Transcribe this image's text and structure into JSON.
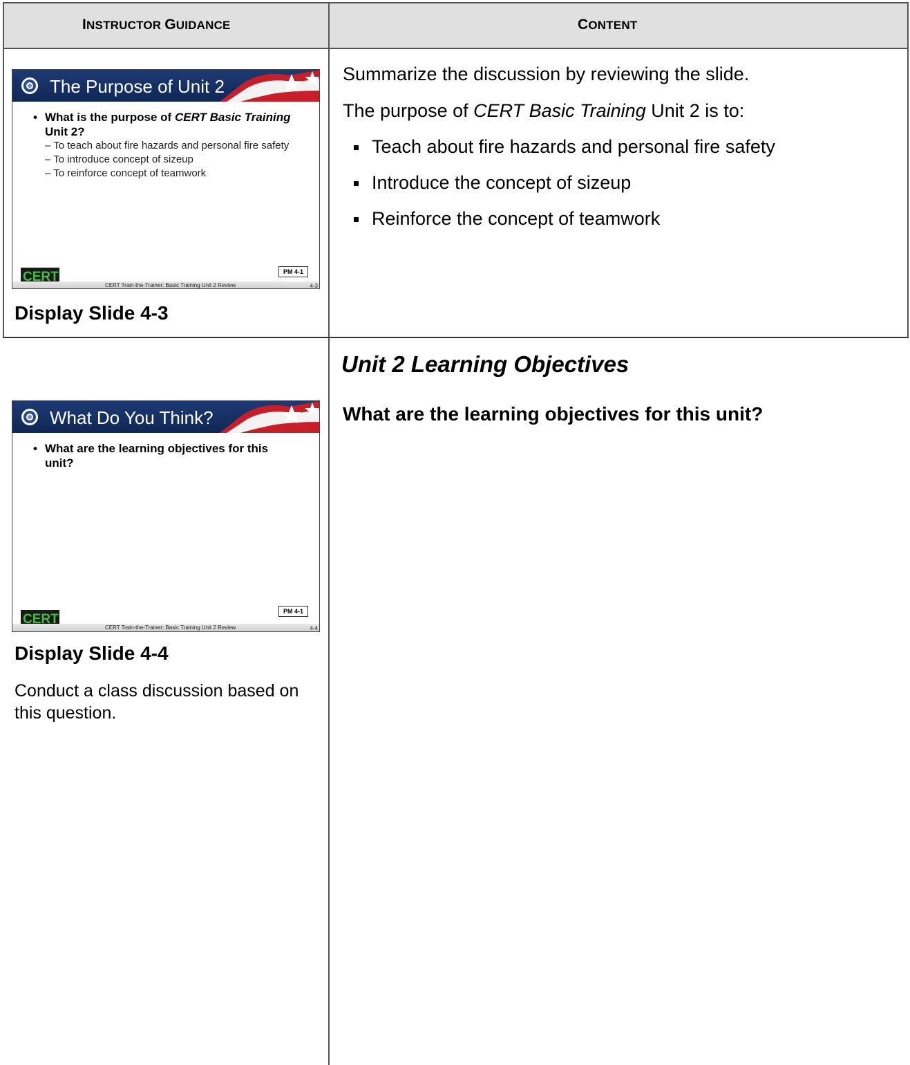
{
  "header": {
    "col1_first": "I",
    "col1_rest": "NSTRUCTOR ",
    "col1_first2": "G",
    "col1_rest2": "UIDANCE",
    "col2_first": "C",
    "col2_rest": "ONTENT"
  },
  "row1": {
    "slide": {
      "title": "The Purpose of Unit 2",
      "question_a": "What is the purpose of ",
      "question_b": "CERT Basic Training",
      "question_c": " Unit 2?",
      "subs": [
        "– To teach about fire hazards and personal fire safety",
        "– To introduce concept of sizeup",
        "– To reinforce concept of teamwork"
      ],
      "pm": "PM 4-1",
      "footer": "CERT Train-the-Trainer:  Basic Training Unit 2 Review",
      "page": "4-3"
    },
    "label": "Display Slide 4-3",
    "content_intro": "Summarize the discussion by reviewing the slide.",
    "purpose_a": "The purpose of ",
    "purpose_b": "CERT Basic Training",
    "purpose_c": " Unit 2 is to:",
    "bullets": [
      "Teach about fire hazards and personal fire safety",
      "Introduce the concept of sizeup",
      "Reinforce the concept of teamwork"
    ]
  },
  "row2": {
    "slide": {
      "title": "What Do You Think?",
      "question": "What are the learning objectives for this unit?",
      "pm": "PM 4-1",
      "footer": "CERT Train-the-Trainer:  Basic Training Unit 2 Review",
      "page": "4-4"
    },
    "label": "Display Slide 4-4",
    "instruction": "Conduct a class discussion based on this question.",
    "heading": "Unit 2 Learning Objectives",
    "question": "What are the learning objectives for this unit?"
  }
}
